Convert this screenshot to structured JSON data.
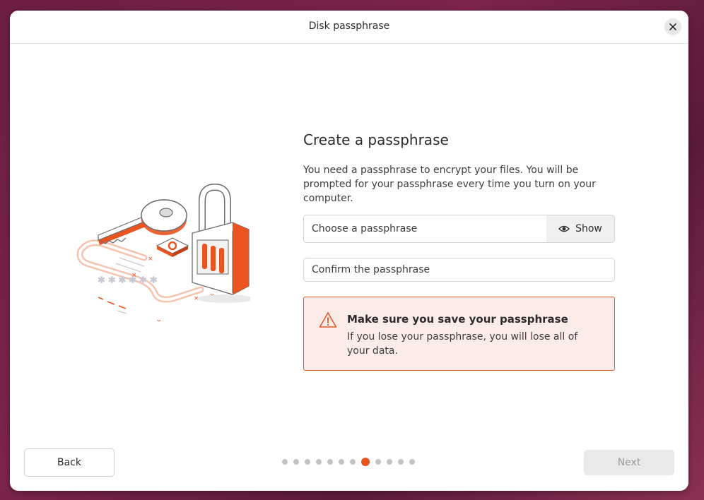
{
  "dialog": {
    "title": "Disk passphrase",
    "close_icon": "close-icon"
  },
  "illustration": {
    "icon": "key-and-padlock-illustration"
  },
  "main": {
    "heading": "Create a passphrase",
    "description": "You need a passphrase to encrypt your files. You will be prompted for your passphrase every time you turn on your computer.",
    "passphrase_placeholder": "Choose a passphrase",
    "passphrase_value": "",
    "show_label": "Show",
    "show_icon": "eye-icon",
    "confirm_placeholder": "Confirm the passphrase",
    "confirm_value": ""
  },
  "warning": {
    "icon": "warning-icon",
    "title": "Make sure you save your passphrase",
    "text": "If you lose your passphrase, you will lose all of your data.",
    "accent_color": "#e05a2a",
    "background_color": "#fbece7"
  },
  "footer": {
    "back_label": "Back",
    "next_label": "Next",
    "next_enabled": false,
    "progress": {
      "total_steps": 12,
      "current_step": 8,
      "active_color": "#e95420"
    }
  }
}
